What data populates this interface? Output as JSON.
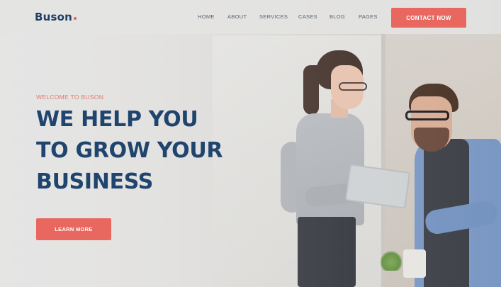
{
  "brand": {
    "name": "Buson",
    "accent_color": "#e8685f",
    "primary_color": "#1f446e"
  },
  "nav": {
    "items": [
      {
        "label": "HOME"
      },
      {
        "label": "ABOUT"
      },
      {
        "label": "SERVICES"
      },
      {
        "label": "CASES"
      },
      {
        "label": "BLOG"
      },
      {
        "label": "PAGES"
      }
    ],
    "cta_label": "CONTACT NOW"
  },
  "hero": {
    "eyebrow": "WELCOME TO BUSON",
    "headline_lines": [
      "WE HELP YOU",
      "TO GROW YOUR",
      "BUSINESS"
    ],
    "button_label": "LEARN MORE"
  }
}
